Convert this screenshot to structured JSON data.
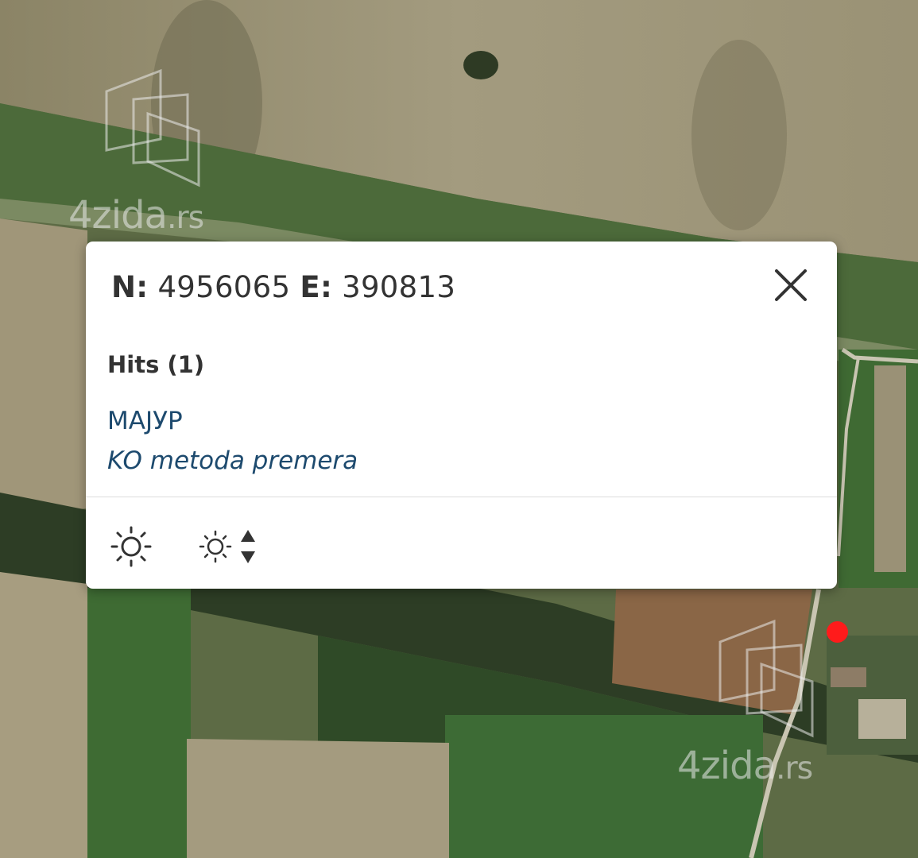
{
  "map": {
    "watermarks": [
      {
        "text": "4zida",
        "tld": ".rs"
      },
      {
        "text": "4zida",
        "tld": ".rs"
      }
    ],
    "marker_color": "#ff1b1b"
  },
  "popup": {
    "coordinates": {
      "n_label": "N:",
      "n_value": "4956065",
      "e_label": "E:",
      "e_value": "390813"
    },
    "close_icon": "close-icon",
    "hits_label": "Hits (1)",
    "hits": [
      {
        "name": "МАЈУР",
        "description": "KO metoda premera"
      }
    ],
    "toolbar": [
      {
        "icon": "brightness-icon"
      },
      {
        "icon": "brightness-adjust-icon"
      }
    ],
    "link_color": "#1d4a6e"
  }
}
